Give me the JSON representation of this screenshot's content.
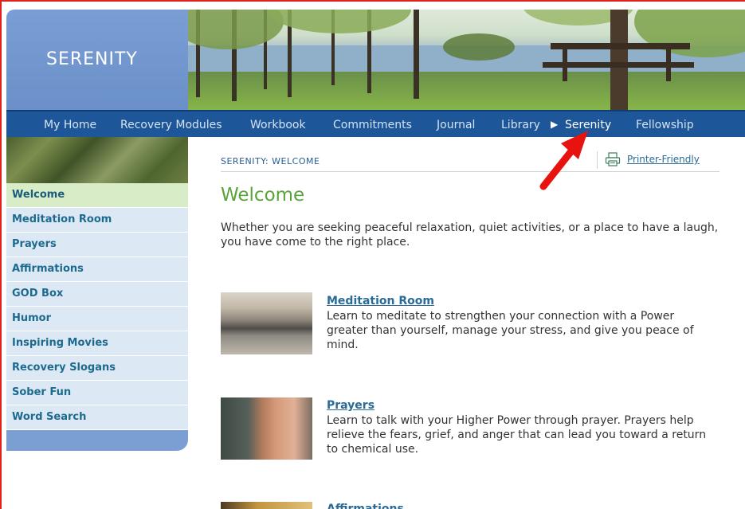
{
  "logo": {
    "text": "SERENITY"
  },
  "nav": {
    "items": [
      {
        "label": "My Home"
      },
      {
        "label": "Recovery Modules"
      },
      {
        "label": "Workbook"
      },
      {
        "label": "Commitments"
      },
      {
        "label": "Journal"
      },
      {
        "label": "Library"
      },
      {
        "label": "Serenity",
        "active": true
      },
      {
        "label": "Fellowship"
      }
    ],
    "active_indicator_icon": "triangle-right-icon"
  },
  "sidebar": {
    "items": [
      {
        "label": "Welcome",
        "active": true
      },
      {
        "label": "Meditation Room"
      },
      {
        "label": "Prayers"
      },
      {
        "label": "Affirmations"
      },
      {
        "label": "GOD Box"
      },
      {
        "label": "Humor"
      },
      {
        "label": "Inspiring Movies"
      },
      {
        "label": "Recovery Slogans"
      },
      {
        "label": "Sober Fun"
      },
      {
        "label": "Word Search"
      }
    ]
  },
  "main": {
    "breadcrumb": "SERENITY: WELCOME",
    "printer_friendly": "Printer-Friendly",
    "printer_icon": "printer-icon",
    "title": "Welcome",
    "intro": "Whether you are seeking peaceful relaxation, quiet activities, or a place to have a laugh, you have come to the right place.",
    "cards": [
      {
        "title": "Meditation Room",
        "text": "Learn to meditate to strengthen your connection with a Power greater than yourself, manage your stress, and give you peace of mind."
      },
      {
        "title": "Prayers",
        "text": "Learn to talk with your Higher Power through prayer. Prayers help relieve the fears, grief, and anger that can lead you toward a return to chemical use."
      },
      {
        "title": "Affirmations",
        "text": ""
      }
    ]
  },
  "colors": {
    "nav_bg": "#1d5799",
    "logo_bg": "#7a9ed4",
    "sidebar_bg": "#dde8f5",
    "sidebar_active_bg": "#d8ecc8",
    "title_green": "#5aa33b",
    "link_blue": "#2a6a98",
    "annotation_red": "#e0201c"
  }
}
